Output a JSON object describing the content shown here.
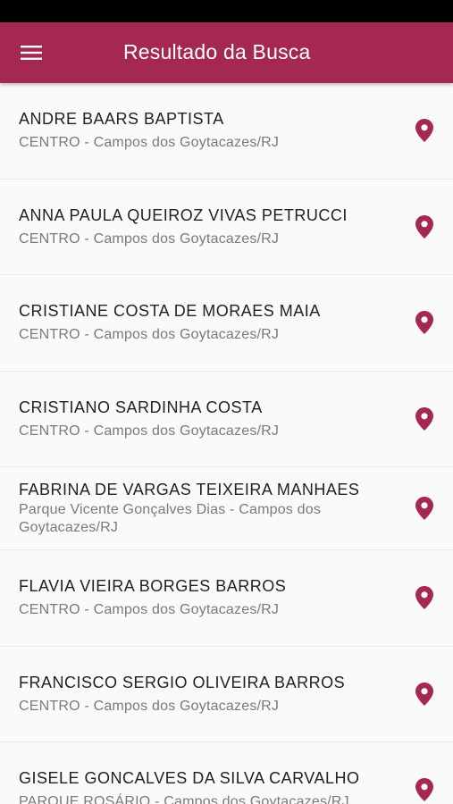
{
  "app": {
    "title": "Resultado da Busca",
    "accent_color": "#a4284f",
    "menu_icon": "hamburger-menu-icon"
  },
  "results": [
    {
      "name": "ANDRE BAARS BAPTISTA",
      "address": "CENTRO - Campos dos Goytacazes/RJ",
      "icon": "location-pin-icon"
    },
    {
      "name": "ANNA PAULA QUEIROZ VIVAS PETRUCCI",
      "address": "CENTRO - Campos dos Goytacazes/RJ",
      "icon": "location-pin-icon"
    },
    {
      "name": "CRISTIANE COSTA DE MORAES MAIA",
      "address": "CENTRO - Campos dos Goytacazes/RJ",
      "icon": "location-pin-icon"
    },
    {
      "name": "CRISTIANO SARDINHA COSTA",
      "address": "CENTRO - Campos dos Goytacazes/RJ",
      "icon": "location-pin-icon"
    },
    {
      "name": "FABRINA DE VARGAS TEIXEIRA MANHAES",
      "address": "Parque Vicente Gonçalves Dias - Campos dos Goytacazes/RJ",
      "icon": "location-pin-icon"
    },
    {
      "name": "FLAVIA VIEIRA BORGES BARROS",
      "address": "CENTRO - Campos dos Goytacazes/RJ",
      "icon": "location-pin-icon"
    },
    {
      "name": "FRANCISCO SERGIO OLIVEIRA BARROS",
      "address": "CENTRO - Campos dos Goytacazes/RJ",
      "icon": "location-pin-icon"
    },
    {
      "name": "GISELE GONCALVES DA SILVA CARVALHO",
      "address": "PARQUE ROSÁRIO - Campos dos Goytacazes/RJ",
      "icon": "location-pin-icon"
    }
  ]
}
